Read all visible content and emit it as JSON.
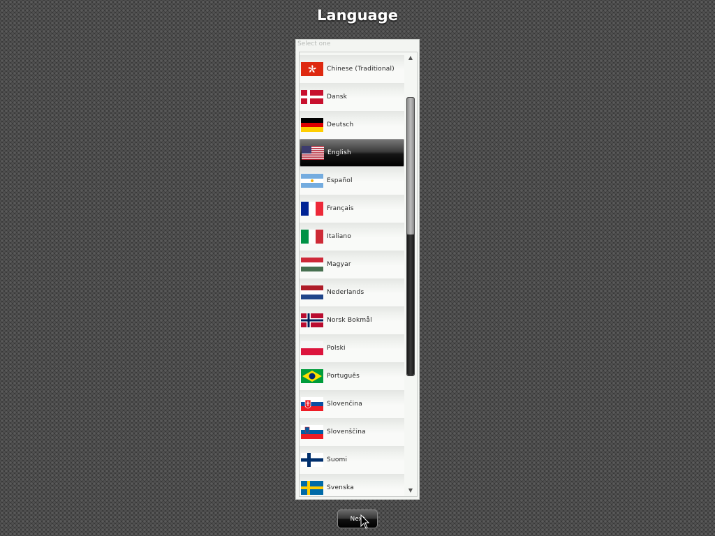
{
  "header": {
    "title": "Language"
  },
  "list": {
    "caption": "Select one",
    "selected_index": 3,
    "scroll_position": 0.0,
    "items": [
      {
        "label": "Chinese (Traditional)",
        "flag": "hong-kong"
      },
      {
        "label": "Dansk",
        "flag": "denmark"
      },
      {
        "label": "Deutsch",
        "flag": "germany"
      },
      {
        "label": "English",
        "flag": "usa"
      },
      {
        "label": "Español",
        "flag": "argentina"
      },
      {
        "label": "Français",
        "flag": "france"
      },
      {
        "label": "Italiano",
        "flag": "italy"
      },
      {
        "label": "Magyar",
        "flag": "hungary"
      },
      {
        "label": "Nederlands",
        "flag": "netherlands"
      },
      {
        "label": "Norsk Bokmål",
        "flag": "norway"
      },
      {
        "label": "Polski",
        "flag": "poland"
      },
      {
        "label": "Português",
        "flag": "brazil"
      },
      {
        "label": "Slovenčina",
        "flag": "slovakia"
      },
      {
        "label": "Slovenščina",
        "flag": "slovenia"
      },
      {
        "label": "Suomi",
        "flag": "finland"
      },
      {
        "label": "Svenska",
        "flag": "sweden"
      }
    ]
  },
  "footer": {
    "next_label": "Next"
  },
  "colors": {
    "background": "#3a3a3a",
    "panel": "#f3f5f2",
    "selected_row": "#151515",
    "title_text": "#ffffff"
  }
}
